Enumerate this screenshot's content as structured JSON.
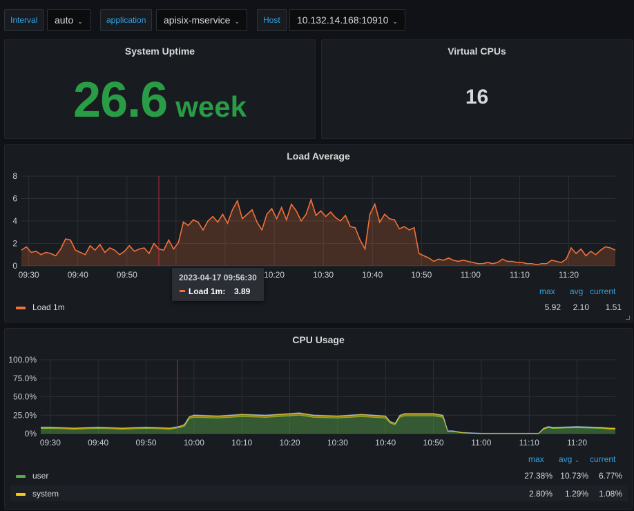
{
  "variables": {
    "interval_label": "Interval",
    "interval_value": "auto",
    "application_label": "application",
    "application_value": "apisix-mservice",
    "host_label": "Host",
    "host_value": "10.132.14.168:10910"
  },
  "uptime": {
    "title": "System Uptime",
    "value": "26.6",
    "unit": "week"
  },
  "vcpus": {
    "title": "Virtual CPUs",
    "value": "16"
  },
  "load": {
    "title": "Load Average",
    "legend_headers": {
      "max": "max",
      "avg": "avg",
      "current": "current"
    },
    "series_name": "Load 1m",
    "stats": {
      "max": "5.92",
      "avg": "2.10",
      "current": "1.51"
    },
    "tooltip": {
      "time": "2023-04-17 09:56:30",
      "name": "Load 1m:",
      "value": "3.89"
    }
  },
  "cpu": {
    "title": "CPU Usage",
    "legend_headers": {
      "max": "max",
      "avg": "avg",
      "current": "current"
    },
    "sort_icon": "chevron-down-icon",
    "rows": [
      {
        "name": "user",
        "color": "#56a64b",
        "max": "27.38%",
        "avg": "10.73%",
        "current": "6.77%"
      },
      {
        "name": "system",
        "color": "#f2cc0c",
        "max": "2.80%",
        "avg": "1.29%",
        "current": "1.08%"
      }
    ]
  },
  "chart_data": [
    {
      "type": "line",
      "title": "Load Average",
      "x_ticks": [
        "09:30",
        "09:40",
        "09:50",
        "10:00",
        "10:10",
        "10:20",
        "10:30",
        "10:40",
        "10:50",
        "11:00",
        "11:10",
        "11:20"
      ],
      "y_ticks": [
        "0",
        "2",
        "4",
        "6",
        "8"
      ],
      "ylim": [
        0,
        8
      ],
      "xlim_minutes_from_0930": [
        -1.5,
        119.5
      ],
      "series": [
        {
          "name": "Load 1m",
          "color": "#f2713a",
          "x_minutes_from_0930": [
            -1.5,
            -0.5,
            0.5,
            1.5,
            2.5,
            3.5,
            4.5,
            5.5,
            6.5,
            7.5,
            8.5,
            9.5,
            10.5,
            11.5,
            12.5,
            13.5,
            14.5,
            15.5,
            16.5,
            17.5,
            18.5,
            19.5,
            20.5,
            21.5,
            22.5,
            23.5,
            24.5,
            25.5,
            26.5,
            27.5,
            28.5,
            29.5,
            30.5,
            31.5,
            32.5,
            33.5,
            34.5,
            35.5,
            36.5,
            37.5,
            38.5,
            39.5,
            40.5,
            41.5,
            42.5,
            43.5,
            44.5,
            45.5,
            46.5,
            47.5,
            48.5,
            49.5,
            50.5,
            51.5,
            52.5,
            53.5,
            54.5,
            55.5,
            56.5,
            57.5,
            58.5,
            59.5,
            60.5,
            61.5,
            62.5,
            63.5,
            64.5,
            65.5,
            66.5,
            67.5,
            68.5,
            69.5,
            70.5,
            71.5,
            72.5,
            73.5,
            74.5,
            75.5,
            76.5,
            77.5,
            78.5,
            79.5,
            80.5,
            81.5,
            82.5,
            83.5,
            84.5,
            85.5,
            86.5,
            87.5,
            88.5,
            89.5,
            90.5,
            91.5,
            92.5,
            93.5,
            94.5,
            95.5,
            96.5,
            97.5,
            98.5,
            99.5,
            100.5,
            101.5,
            102.5,
            103.5,
            104.5,
            105.5,
            106.5,
            107.5,
            108.5,
            109.5,
            110.5,
            111.5,
            112.5,
            113.5,
            114.5,
            115.5,
            116.5,
            117.5,
            118.5,
            119.5
          ],
          "y": [
            1.4,
            1.7,
            1.2,
            1.3,
            1.0,
            1.2,
            1.1,
            0.9,
            1.5,
            2.4,
            2.3,
            1.4,
            1.2,
            1.0,
            1.8,
            1.4,
            1.9,
            1.2,
            1.6,
            1.4,
            1.0,
            1.3,
            1.8,
            1.3,
            1.5,
            1.6,
            1.1,
            2.0,
            1.5,
            1.4,
            2.3,
            1.5,
            2.1,
            3.9,
            3.6,
            4.1,
            3.9,
            3.2,
            4.0,
            4.4,
            3.9,
            4.6,
            3.8,
            5.0,
            5.8,
            4.2,
            4.6,
            5.0,
            3.9,
            3.2,
            4.6,
            5.1,
            4.2,
            5.2,
            4.1,
            5.5,
            4.9,
            4.0,
            4.6,
            5.9,
            4.5,
            4.9,
            4.4,
            4.8,
            4.3,
            4.0,
            4.5,
            3.5,
            3.4,
            2.3,
            1.5,
            4.6,
            5.5,
            3.9,
            4.6,
            4.2,
            4.1,
            3.3,
            3.5,
            3.2,
            3.4,
            1.1,
            0.9,
            0.7,
            0.4,
            0.6,
            0.5,
            0.7,
            0.5,
            0.4,
            0.5,
            0.4,
            0.3,
            0.2,
            0.2,
            0.3,
            0.2,
            0.3,
            0.6,
            0.4,
            0.4,
            0.3,
            0.3,
            0.2,
            0.2,
            0.1,
            0.2,
            0.2,
            0.5,
            0.4,
            0.3,
            0.6,
            1.6,
            1.1,
            1.5,
            0.9,
            1.3,
            1.0,
            1.4,
            1.7,
            1.6,
            1.4,
            1.8,
            1.2,
            1.5,
            1.8,
            1.3,
            1.9,
            2.2,
            1.5
          ]
        }
      ]
    },
    {
      "type": "area",
      "title": "CPU Usage",
      "x_ticks": [
        "09:30",
        "09:40",
        "09:50",
        "10:00",
        "10:10",
        "10:20",
        "10:30",
        "10:40",
        "10:50",
        "11:00",
        "11:10",
        "11:20"
      ],
      "y_ticks": [
        "0%",
        "25.0%",
        "50.0%",
        "75.0%",
        "100.0%"
      ],
      "ylim": [
        0,
        100
      ],
      "xlim_minutes_from_0930": [
        -2,
        118
      ],
      "stacked": true,
      "series": [
        {
          "name": "user",
          "color": "#56a64b",
          "x_minutes_from_0930": [
            -2,
            0,
            5,
            10,
            15,
            20,
            25,
            26,
            27,
            28,
            29,
            30,
            35,
            40,
            45,
            50,
            52,
            55,
            60,
            65,
            70,
            71,
            72,
            73,
            74,
            75,
            80,
            82,
            83,
            84,
            85,
            86,
            90,
            95,
            100,
            101,
            102,
            103,
            104,
            105,
            110,
            115,
            117,
            118
          ],
          "y": [
            7,
            7,
            6,
            7,
            6,
            7,
            6,
            7,
            8,
            10,
            20,
            22,
            21,
            23,
            22,
            24,
            25,
            22,
            21,
            23,
            21,
            14,
            12,
            22,
            24,
            24,
            24,
            22,
            3,
            3,
            2,
            1,
            0,
            0,
            0,
            0,
            0,
            6,
            8,
            7,
            8,
            7,
            6,
            6
          ]
        },
        {
          "name": "system",
          "color": "#f2cc0c",
          "x_minutes_from_0930": [
            -2,
            0,
            5,
            10,
            15,
            20,
            25,
            26,
            27,
            28,
            29,
            30,
            35,
            40,
            45,
            50,
            52,
            55,
            60,
            65,
            70,
            71,
            72,
            73,
            74,
            75,
            80,
            82,
            83,
            84,
            85,
            86,
            90,
            95,
            100,
            101,
            102,
            103,
            104,
            105,
            110,
            115,
            117,
            118
          ],
          "y": [
            1.5,
            1.5,
            1.2,
            1.5,
            1.2,
            1.5,
            1.2,
            1.5,
            1.6,
            2,
            2.5,
            2.8,
            2.6,
            2.8,
            2.7,
            2.8,
            2.8,
            2.7,
            2.6,
            2.8,
            2.6,
            2,
            1.8,
            2.6,
            2.8,
            2.8,
            2.8,
            2.6,
            0.6,
            0.5,
            0.4,
            0.3,
            0.1,
            0.1,
            0.1,
            0.1,
            0.2,
            1,
            1.2,
            1.1,
            1.2,
            1.1,
            1.1,
            1.08
          ]
        }
      ]
    }
  ]
}
